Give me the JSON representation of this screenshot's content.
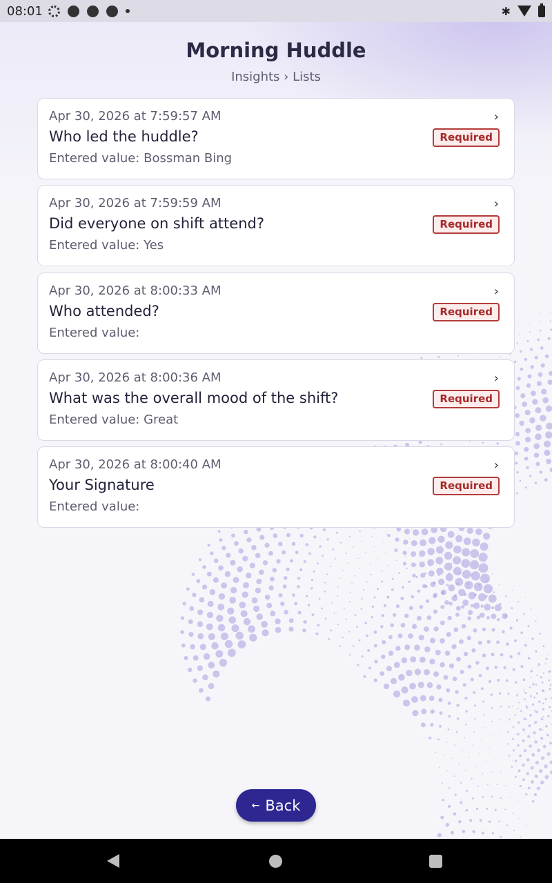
{
  "status_bar": {
    "time": "08:01",
    "icons": [
      "settings-icon",
      "basketball-icon",
      "basketball-icon",
      "basketball-icon",
      "dot-icon"
    ],
    "right_icons": [
      "bluetooth-icon",
      "wifi-icon",
      "battery-icon"
    ]
  },
  "header": {
    "title": "Morning Huddle",
    "breadcrumb": "Insights › Lists"
  },
  "items": [
    {
      "timestamp": "Apr 30, 2026 at 7:59:57 AM",
      "question": "Who led the huddle?",
      "value": "Entered value: Bossman Bing",
      "badge": "Required"
    },
    {
      "timestamp": "Apr 30, 2026 at 7:59:59 AM",
      "question": "Did everyone on shift attend?",
      "value": "Entered value: Yes",
      "badge": "Required"
    },
    {
      "timestamp": "Apr 30, 2026 at 8:00:33 AM",
      "question": "Who attended?",
      "value": "Entered value:",
      "badge": "Required"
    },
    {
      "timestamp": "Apr 30, 2026 at 8:00:36 AM",
      "question": "What was the overall mood of the shift?",
      "value": "Entered value: Great",
      "badge": "Required"
    },
    {
      "timestamp": "Apr 30, 2026 at 8:00:40 AM",
      "question": "Your Signature",
      "value": "Entered value:",
      "badge": "Required"
    }
  ],
  "chevron": "›",
  "back_button": {
    "arrow": "←",
    "label": "Back"
  },
  "colors": {
    "accent": "#2e2691",
    "badge_border": "#b33b3b",
    "badge_bg": "#fdecec",
    "badge_text": "#a52a2a"
  }
}
